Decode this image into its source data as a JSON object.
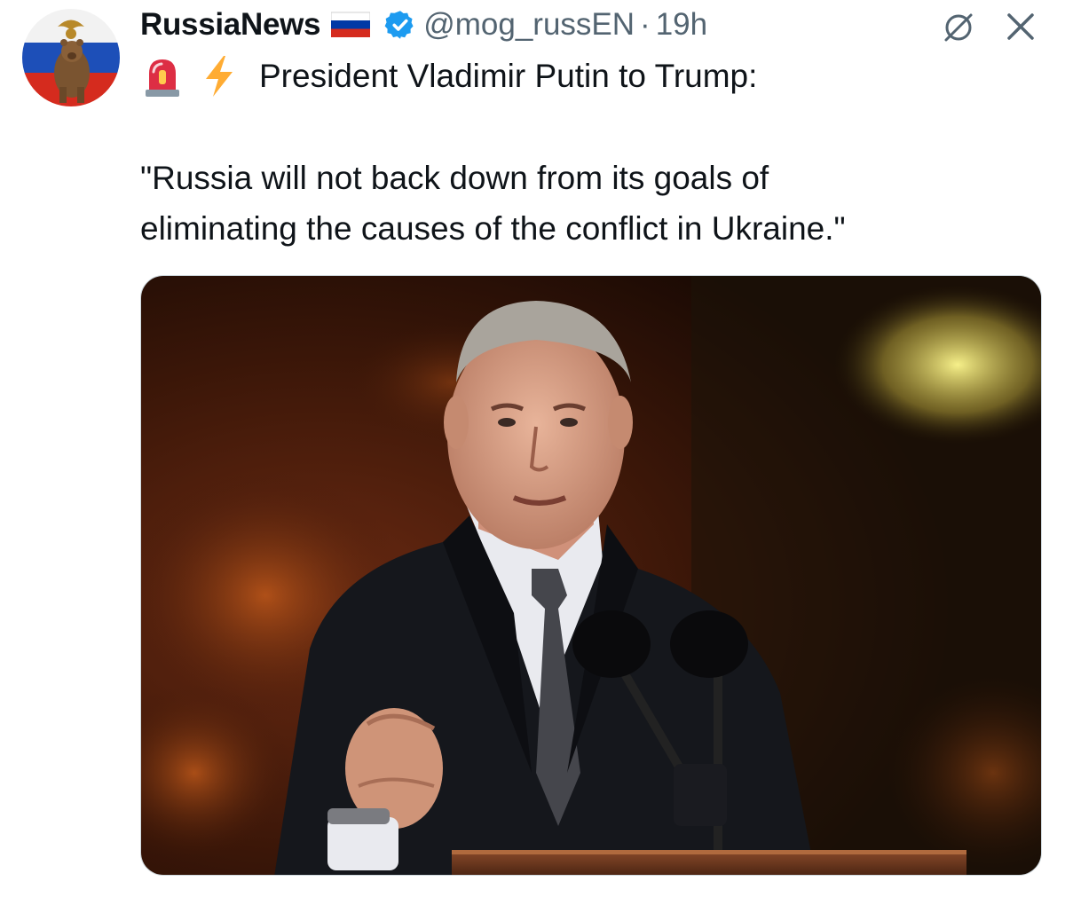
{
  "tweet": {
    "display_name": "RussiaNews",
    "handle": "@mog_russEN",
    "separator": "·",
    "time": "19h",
    "headline": "President Vladimir Putin to Trump:",
    "quote_line_1": "\"Russia will not back down from its goals of",
    "quote_line_2": "eliminating the causes of the conflict in Ukraine.\""
  },
  "icons": {
    "flag": "russia-flag-icon",
    "verified": "verified-badge-icon",
    "grok": "grok-icon",
    "close": "close-icon",
    "siren": "siren-emoji",
    "bolt": "lightning-emoji"
  },
  "colors": {
    "verified_blue": "#1d9bf0",
    "text_primary": "#0f1419",
    "text_secondary": "#536471",
    "flag_white": "#ffffff",
    "flag_blue": "#0039a6",
    "flag_red": "#d52b1e",
    "bolt_yellow": "#ffac33",
    "siren_red": "#dd2e44"
  }
}
